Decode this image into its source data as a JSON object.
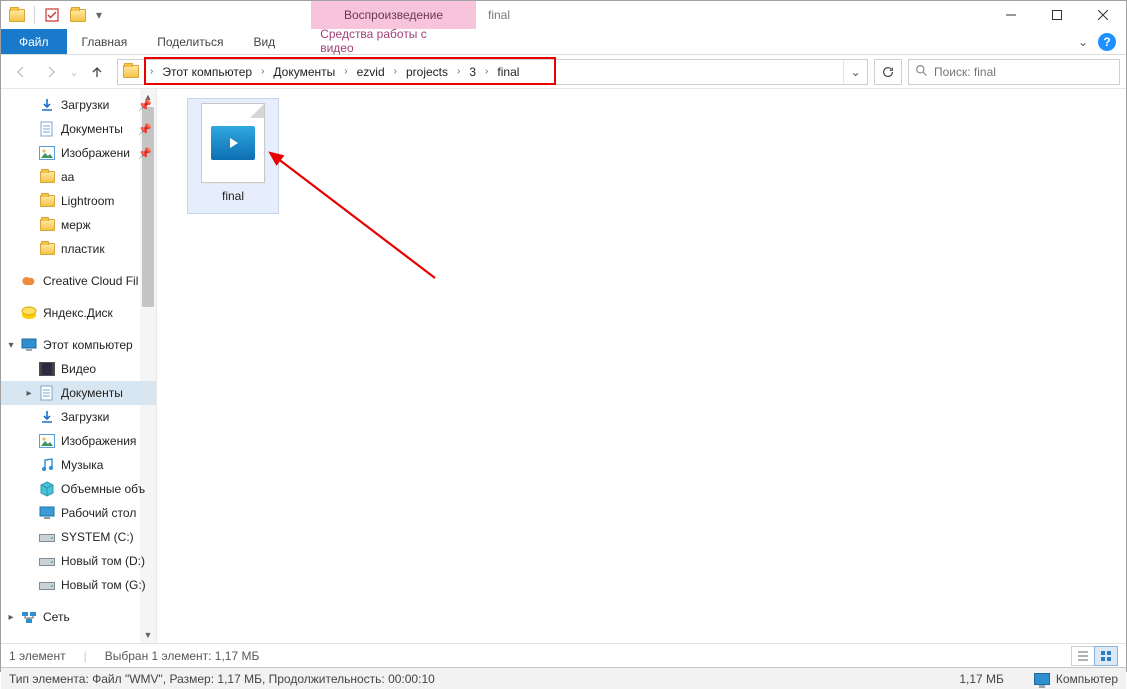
{
  "window": {
    "contextual_tab": "Воспроизведение",
    "title": "final",
    "minimize_tip": "Свернуть",
    "maximize_tip": "Развернуть",
    "close_tip": "Закрыть"
  },
  "ribbon": {
    "file": "Файл",
    "home": "Главная",
    "share": "Поделиться",
    "view": "Вид",
    "contextual": "Средства работы с видео"
  },
  "nav": {
    "breadcrumb": [
      "Этот компьютер",
      "Документы",
      "ezvid",
      "projects",
      "3",
      "final"
    ],
    "search_placeholder": "Поиск: final"
  },
  "sidebar": {
    "items": [
      {
        "label": "Загрузки",
        "icon": "download",
        "pin": true,
        "depth": 1
      },
      {
        "label": "Документы",
        "icon": "document",
        "pin": true,
        "depth": 1
      },
      {
        "label": "Изображени",
        "icon": "image",
        "pin": true,
        "depth": 1
      },
      {
        "label": "aa",
        "icon": "folder",
        "depth": 1
      },
      {
        "label": "Lightroom",
        "icon": "folder",
        "depth": 1
      },
      {
        "label": "мерж",
        "icon": "folder",
        "depth": 1
      },
      {
        "label": "пластик",
        "icon": "folder",
        "depth": 1
      },
      {
        "label": "Creative Cloud Fil",
        "icon": "cc",
        "depth": 0,
        "spaceBefore": true
      },
      {
        "label": "Яндекс.Диск",
        "icon": "yandex",
        "depth": 0,
        "spaceBefore": true
      },
      {
        "label": "Этот компьютер",
        "icon": "pc",
        "depth": 0,
        "spaceBefore": true,
        "caret": "▾"
      },
      {
        "label": "Видео",
        "icon": "video",
        "depth": 1
      },
      {
        "label": "Документы",
        "icon": "document",
        "depth": 1,
        "selected": true,
        "caret": "▸"
      },
      {
        "label": "Загрузки",
        "icon": "download",
        "depth": 1
      },
      {
        "label": "Изображения",
        "icon": "image",
        "depth": 1
      },
      {
        "label": "Музыка",
        "icon": "music",
        "depth": 1
      },
      {
        "label": "Объемные объ",
        "icon": "cube",
        "depth": 1
      },
      {
        "label": "Рабочий стол",
        "icon": "desktop",
        "depth": 1
      },
      {
        "label": "SYSTEM (C:)",
        "icon": "drive",
        "depth": 1
      },
      {
        "label": "Новый том (D:)",
        "icon": "drive",
        "depth": 1
      },
      {
        "label": "Новый том (G:)",
        "icon": "drive",
        "depth": 1
      },
      {
        "label": "Сеть",
        "icon": "net",
        "depth": 0,
        "spaceBefore": true,
        "caret": "▸"
      }
    ]
  },
  "content": {
    "files": [
      {
        "name": "final",
        "kind": "video"
      }
    ]
  },
  "status1": {
    "count": "1 элемент",
    "selection": "Выбран 1 элемент: 1,17 МБ"
  },
  "status2": {
    "details": "Тип элемента: Файл \"WMV\", Размер: 1,17 МБ, Продолжительность: 00:00:10",
    "size": "1,17 МБ",
    "computer": "Компьютер"
  }
}
